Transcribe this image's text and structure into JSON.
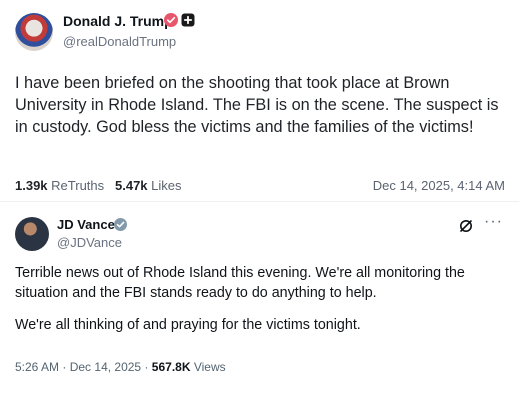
{
  "post1": {
    "display_name": "Donald J. Trump",
    "handle": "@realDonaldTrump",
    "text": "I have been briefed on the shooting that took place at Brown University in Rhode Island. The FBI is on the scene. The suspect is in custody. God bless the victims and the families of the victims!",
    "retruths_count": "1.39k",
    "retruths_label": "ReTruths",
    "likes_count": "5.47k",
    "likes_label": "Likes",
    "timestamp": "Dec 14, 2025, 4:14 AM",
    "verified_badge_color": "#e8566b"
  },
  "post2": {
    "display_name": "JD Vance",
    "handle": "@JDVance",
    "text_p1": "Terrible news out of Rhode Island this evening. We're all monitoring the situation and the FBI stands ready to do anything to help.",
    "text_p2": "We're all thinking of and praying for the victims tonight.",
    "time": "5:26 AM",
    "sep": "·",
    "date": "Dec 14, 2025",
    "views_count": "567.8K",
    "views_label": "Views",
    "verified_badge_color": "#829aab",
    "icons": {
      "grok": "grok-icon",
      "more": "more-icon",
      "more_glyph": "···"
    }
  }
}
